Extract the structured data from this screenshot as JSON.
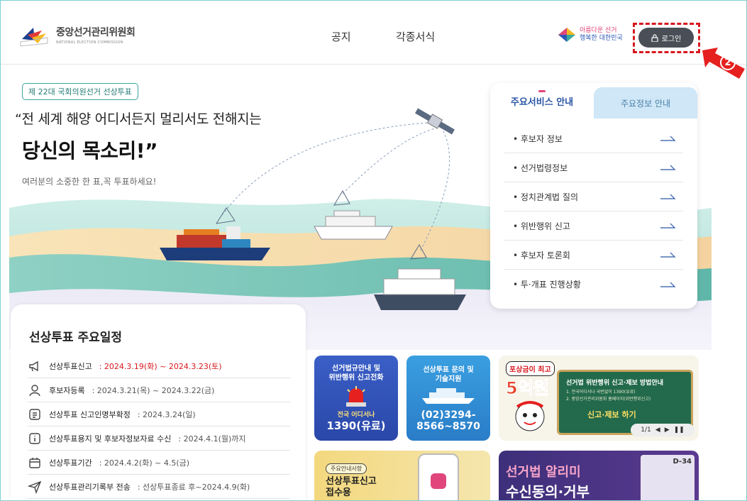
{
  "header": {
    "logo_ko": "중앙선거관리위원회",
    "logo_en": "NATIONAL ELECTION COMMISSION",
    "nav": [
      {
        "label": "공지"
      },
      {
        "label": "각종서식"
      }
    ],
    "slogan_line1": "아름다운 선거",
    "slogan_line2": "행복한 대한민국",
    "login_label": "로그인",
    "callout_number": "2"
  },
  "hero": {
    "tag": "제 22대 국회의원선거 선상투표",
    "headline_1": "“전 세계 해양 어디서든지 멀리서도 전해지는",
    "headline_2": "당신의 목소리!”",
    "subline": "여러분의 소중한 한 표,꼭 투표하세요!"
  },
  "services": {
    "tab_active": "주요서비스 안내",
    "tab_inactive": "주요정보 안내",
    "items": [
      {
        "label": "• 후보자 정보"
      },
      {
        "label": "• 선거법령정보"
      },
      {
        "label": "• 정치관계법 질의"
      },
      {
        "label": "• 위반행위 신고"
      },
      {
        "label": "• 후보자 토론회"
      },
      {
        "label": "• 투·개표 진행상황"
      }
    ]
  },
  "schedule": {
    "title": "선상투표 주요일정",
    "rows": [
      {
        "label": "선상투표신고",
        "date": " : 2024.3.19(화) ~ 2024.3.23(토)",
        "icon": "megaphone-icon",
        "red": true
      },
      {
        "label": "후보자등록",
        "date": " : 2024.3.21(목) ~ 2024.3.22(금)",
        "icon": "person-icon",
        "red": false
      },
      {
        "label": "선상투표 신고인명부확정",
        "date": " :   2024.3.24(일)",
        "icon": "list-doc-icon",
        "red": false
      },
      {
        "label": "선상투표용지 및 후보자정보자료 수신",
        "date": " :   2024.4.1(월)까지",
        "icon": "info-icon",
        "red": false
      },
      {
        "label": "선상투표기간",
        "date": " : 2024.4.2(화) ~ 4.5(금)",
        "icon": "calendar-icon",
        "red": false
      },
      {
        "label": "선상투표관리기록부 전송",
        "date": " : 선상투표종료 후~2024.4.9(화)",
        "icon": "send-icon",
        "red": false
      }
    ]
  },
  "banners": {
    "b1_title": "선거법규안내 및\n위반행위 신고전화",
    "b1_sub": "전국 어디서나",
    "b1_number": "1390(유료)",
    "b2_title": "선상투표 문의 및\n기술지원",
    "b2_number": "(02)3294-\n8566~8570",
    "b3_badge": "포상금이 최고",
    "b3_big": "5억원",
    "b3_title": "선거법 위반행위 신고·제보 방법안내",
    "b3_line1": "1. 전국어디서나 국번없이 1390(유료)",
    "b3_line2": "2. 중앙선거관리위원회 홈페이지(위반행위신고)",
    "b3_cta": "신고·제보 하기",
    "b3_pager": "1/1",
    "b4_pill": "주요안내사항",
    "b4_title": "선상투표신고\n접수용",
    "b5_title": "선거법 알리미",
    "b5_sub": "수신동의·거부",
    "b5_dday": "D-34"
  },
  "colors": {
    "accent": "#2a56a5",
    "login_bg": "#4a4f57",
    "highlight": "#d8181f",
    "tag_border": "#3aa99f"
  }
}
